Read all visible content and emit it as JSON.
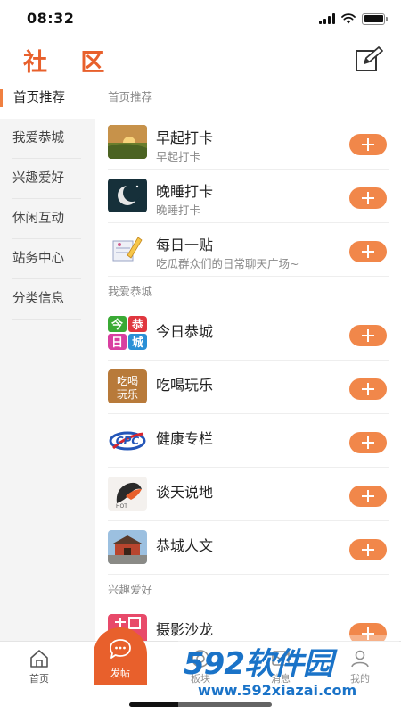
{
  "status_bar": {
    "time": "08:32"
  },
  "header": {
    "title": "社 区"
  },
  "sidebar": {
    "items": [
      {
        "label": "首页推荐",
        "active": true
      },
      {
        "label": "我爱恭城"
      },
      {
        "label": "兴趣爱好"
      },
      {
        "label": "休闲互动"
      },
      {
        "label": "站务中心"
      },
      {
        "label": "分类信息"
      }
    ]
  },
  "sections": [
    {
      "title": "首页推荐",
      "rows": [
        {
          "title": "早起打卡",
          "subtitle": "早起打卡",
          "icon": "sunrise-icon"
        },
        {
          "title": "晚睡打卡",
          "subtitle": "晚睡打卡",
          "icon": "moon-icon"
        },
        {
          "title": "每日一贴",
          "subtitle": "吃瓜群众们的日常聊天广场~",
          "icon": "paper-pencil-icon"
        }
      ]
    },
    {
      "title": "我爱恭城",
      "rows": [
        {
          "title": "今日恭城",
          "icon": "today-gongcheng-icon",
          "icon_text": [
            "今",
            "恭",
            "日",
            "城"
          ]
        },
        {
          "title": "吃喝玩乐",
          "icon": "eat-drink-play-icon",
          "icon_text": [
            "吃喝",
            "玩乐"
          ]
        },
        {
          "title": "健康专栏",
          "icon": "health-cpc-icon",
          "icon_text": "CPC"
        },
        {
          "title": "谈天说地",
          "icon": "chat-hot-icon",
          "icon_text": "HOT"
        },
        {
          "title": "恭城人文",
          "icon": "temple-icon"
        }
      ]
    },
    {
      "title": "兴趣爱好",
      "rows": [
        {
          "title": "摄影沙龙",
          "icon": "photo-salon-icon"
        }
      ]
    }
  ],
  "tabbar": {
    "items": [
      {
        "label": "首页",
        "icon": "home-icon"
      },
      {
        "label": "发帖",
        "icon": "chat-bubble-icon"
      },
      {
        "label": "板块",
        "icon": "board-icon"
      },
      {
        "label": "消息",
        "icon": "message-icon"
      },
      {
        "label": "我的",
        "icon": "user-icon"
      }
    ]
  },
  "watermark": {
    "logo": "592软件园",
    "url": "www.592xiazai.com"
  },
  "colors": {
    "accent": "#e8602c",
    "button": "#f1874a",
    "sidebar_bg": "#f4f4f4"
  }
}
